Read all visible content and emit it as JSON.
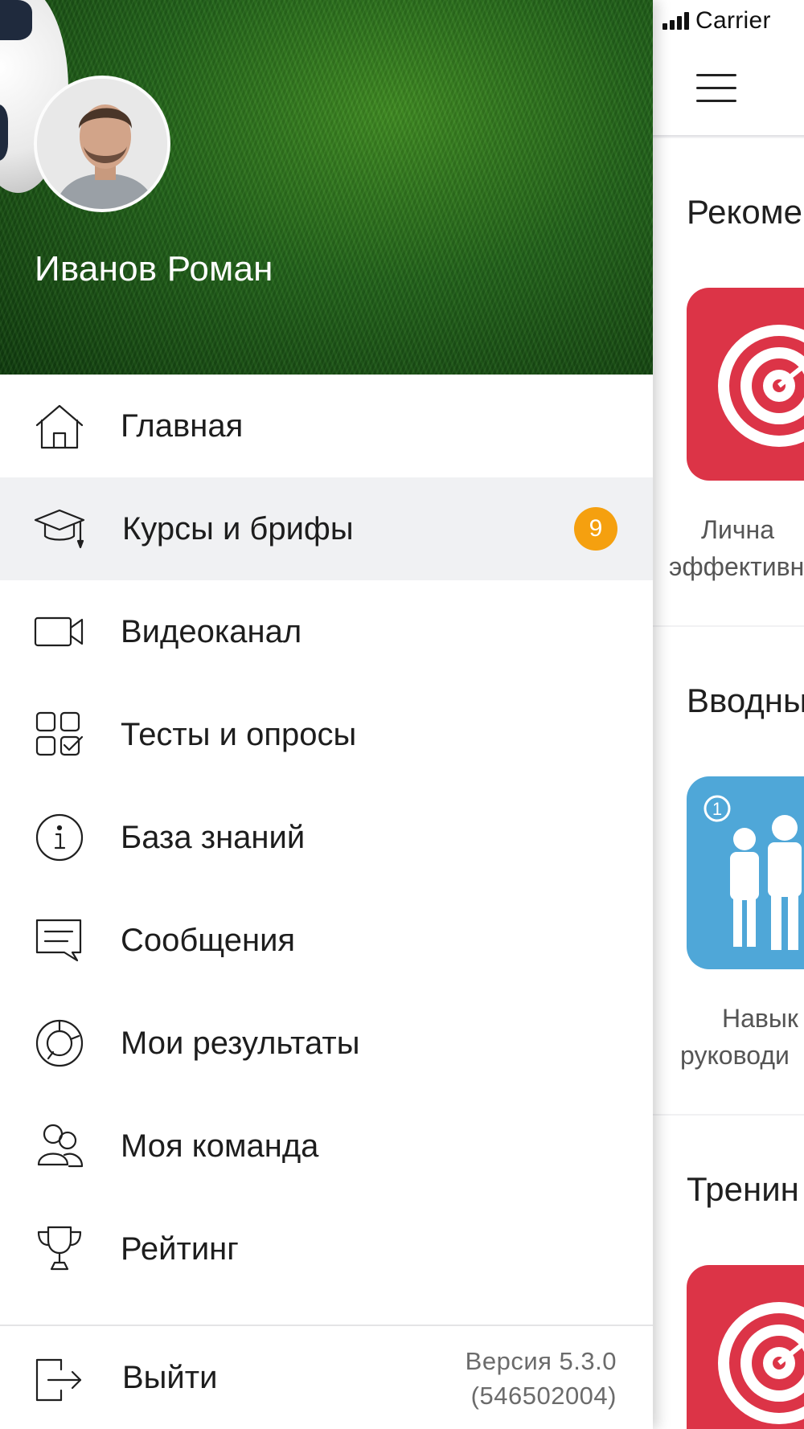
{
  "status_bar": {
    "carrier": "Carrier"
  },
  "user": {
    "name": "Иванов Роман"
  },
  "menu": {
    "items": [
      {
        "label": "Главная",
        "icon": "home-icon"
      },
      {
        "label": "Курсы и брифы",
        "icon": "graduation-cap-icon",
        "badge": "9",
        "active": true
      },
      {
        "label": "Видеоканал",
        "icon": "video-camera-icon"
      },
      {
        "label": "Тесты и опросы",
        "icon": "tests-grid-icon"
      },
      {
        "label": "База знаний",
        "icon": "info-icon"
      },
      {
        "label": "Сообщения",
        "icon": "message-icon"
      },
      {
        "label": "Мои результаты",
        "icon": "results-chart-icon"
      },
      {
        "label": "Моя команда",
        "icon": "team-icon"
      },
      {
        "label": "Рейтинг",
        "icon": "trophy-icon"
      }
    ],
    "logout_label": "Выйти"
  },
  "version": {
    "line1": "Версия 5.3.0",
    "line2": "(546502004)"
  },
  "background": {
    "sections": [
      {
        "title": "Рекоме",
        "caption_line1": "Лична",
        "caption_line2": "эффективн"
      },
      {
        "title": "Вводны",
        "caption_line1": "Навык",
        "caption_line2": "руководи"
      },
      {
        "title": "Тренин"
      }
    ]
  },
  "colors": {
    "badge": "#f5a00f",
    "tile_red": "#dc3447",
    "tile_blue": "#4fa7d8",
    "active_row": "#f0f1f3"
  }
}
